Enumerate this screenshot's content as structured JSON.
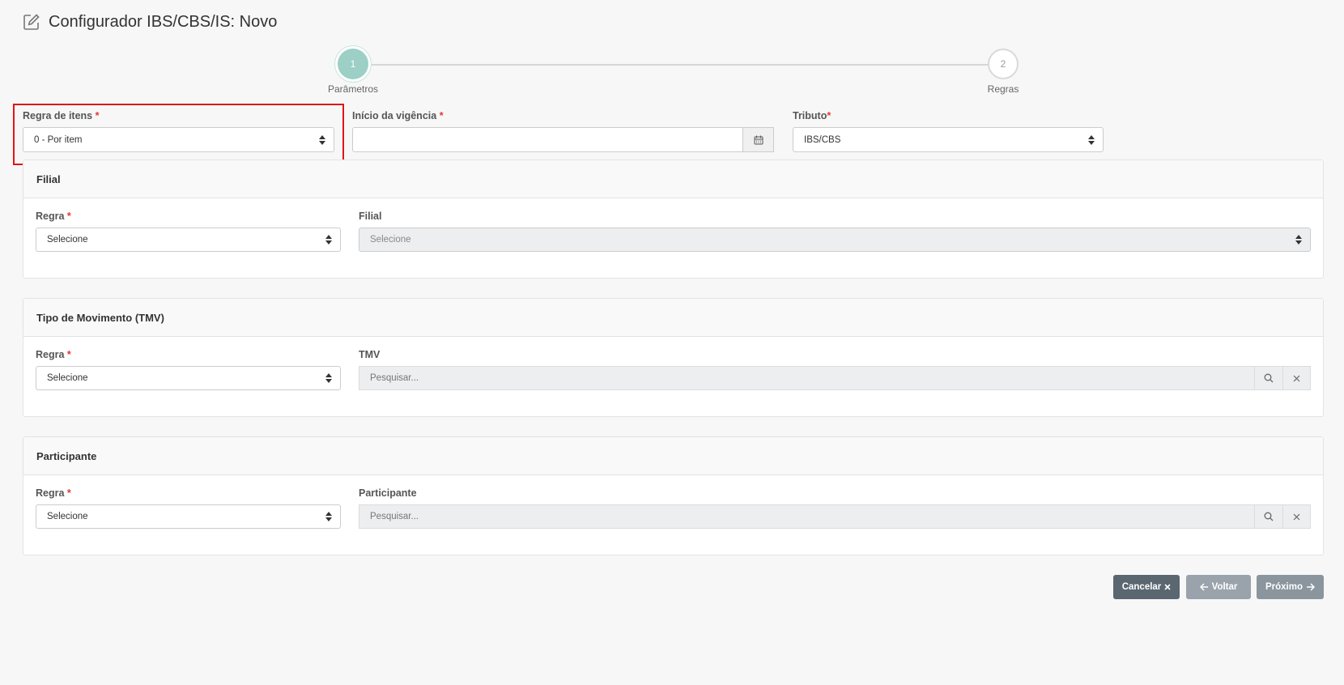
{
  "header": {
    "title": "Configurador IBS/CBS/IS: Novo",
    "icon": "edit-icon"
  },
  "stepper": [
    {
      "number": "1",
      "label": "Parâmetros",
      "active": true
    },
    {
      "number": "2",
      "label": "Regras",
      "active": false
    }
  ],
  "params": {
    "regra_itens": {
      "label": "Regra de itens",
      "required": "*",
      "value": "0 - Por item"
    },
    "inicio_vigencia": {
      "label": "Início da vigência",
      "required": "*",
      "value": ""
    },
    "tributo": {
      "label": "Tributo",
      "required": "*",
      "value": "IBS/CBS"
    }
  },
  "panels": {
    "filial": {
      "title": "Filial",
      "regra_label": "Regra",
      "regra_required": "*",
      "regra_value": "Selecione",
      "field_label": "Filial",
      "field_value": "Selecione"
    },
    "tmv": {
      "title": "Tipo de Movimento (TMV)",
      "regra_label": "Regra",
      "regra_required": "*",
      "regra_value": "Selecione",
      "field_label": "TMV",
      "field_placeholder": "Pesquisar..."
    },
    "participante": {
      "title": "Participante",
      "regra_label": "Regra",
      "regra_required": "*",
      "regra_value": "Selecione",
      "field_label": "Participante",
      "field_placeholder": "Pesquisar..."
    }
  },
  "buttons": {
    "cancel": "Cancelar",
    "back": "Voltar",
    "next": "Próximo"
  },
  "colors": {
    "highlight": "#e01515",
    "step_active": "#9ccfc6",
    "required": "#e53935"
  }
}
